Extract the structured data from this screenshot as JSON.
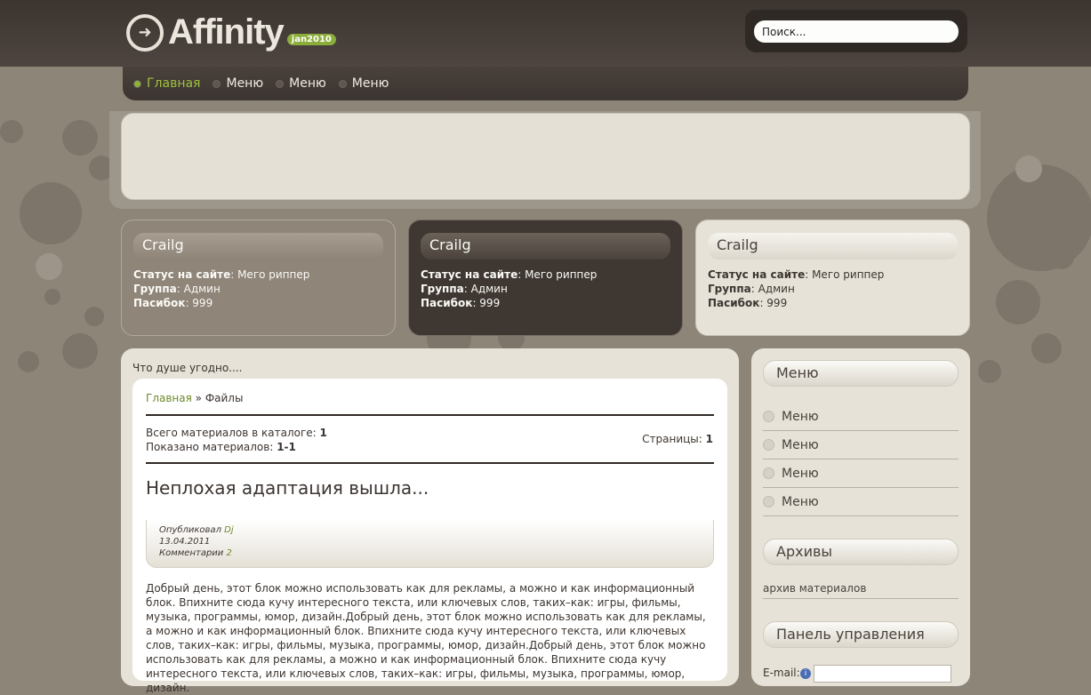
{
  "header": {
    "logo_text": "Affinity",
    "logo_badge": "jan2010",
    "search_placeholder": "Поиск..."
  },
  "nav": {
    "items": [
      {
        "label": "Главная",
        "active": true
      },
      {
        "label": "Меню",
        "active": false
      },
      {
        "label": "Меню",
        "active": false
      },
      {
        "label": "Меню",
        "active": false
      }
    ]
  },
  "cards": [
    {
      "name": "Crailg",
      "status_label": "Статус на сайте",
      "status_value": ": Мего риппер",
      "group_label": "Группа",
      "group_value": ": Админ",
      "thanks_label": "Пасибок",
      "thanks_value": ": 999"
    },
    {
      "name": "Crailg",
      "status_label": "Статус на сайте",
      "status_value": ": Мего риппер",
      "group_label": "Группа",
      "group_value": ": Админ",
      "thanks_label": "Пасибок",
      "thanks_value": ": 999"
    },
    {
      "name": "Crailg",
      "status_label": "Статус на сайте",
      "status_value": ": Мего риппер",
      "group_label": "Группа",
      "group_value": ": Админ",
      "thanks_label": "Пасибок",
      "thanks_value": ": 999"
    }
  ],
  "main": {
    "tagline": "Что душе угодно....",
    "breadcrumb_home": "Главная",
    "breadcrumb_sep": " » ",
    "breadcrumb_current": "Файлы",
    "total_label": "Всего материалов в каталоге: ",
    "total_value": "1",
    "shown_label": "Показано материалов: ",
    "shown_value": "1-1",
    "pages_label": "Страницы: ",
    "pages_value": "1",
    "post_title": "Неплохая адаптация вышла...",
    "meta_author_label": "Опубликовал ",
    "meta_author": "Dj",
    "meta_date": "13.04.2011",
    "meta_comments_label": "Комментарии ",
    "meta_comments": "2",
    "post_body": "Добрый день, этот блок можно использовать как для рекламы, а можно и как информационный блок. Впихните сюда кучу интересного текста, или ключевых слов, таких–как: игры, фильмы, музыка, программы, юмор, дизайн.Добрый день, этот блок можно использовать как для рекламы, а можно и как информационный блок. Впихните сюда кучу интересного текста, или ключевых слов, таких–как: игры, фильмы, музыка, программы, юмор, дизайн.Добрый день, этот блок можно использовать как для рекламы, а можно и как информационный блок. Впихните сюда кучу интересного текста, или ключевых слов, таких–как: игры, фильмы, музыка, программы, юмор, дизайн."
  },
  "sidebar": {
    "menu_title": "Меню",
    "menu_items": [
      "Меню",
      "Меню",
      "Меню",
      "Меню"
    ],
    "archive_title": "Архивы",
    "archive_link": "архив материалов",
    "panel_title": "Панель управления",
    "email_label": "E-mail:"
  },
  "colors": {
    "accent_green": "#8eb33a",
    "link_green": "#6d8a2a",
    "dark_brown": "#3e3732"
  }
}
